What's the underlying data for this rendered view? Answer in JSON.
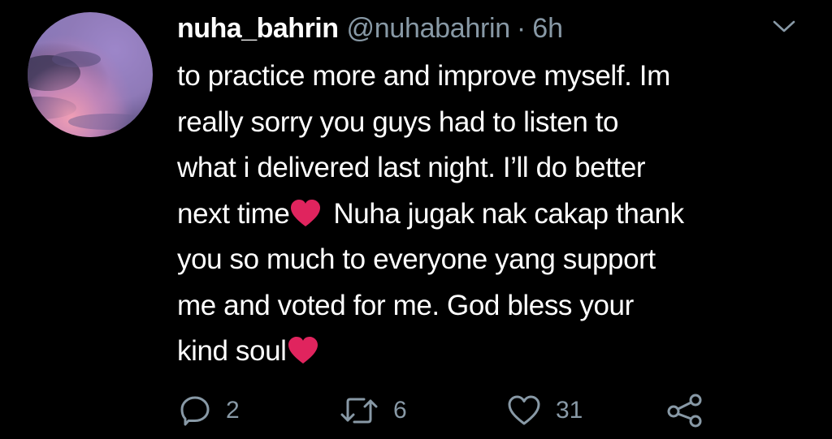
{
  "tweet": {
    "author": {
      "display_name": "nuha_bahrin",
      "handle": "@nuhabahrin",
      "separator": "·",
      "time": "6h"
    },
    "lines": [
      "to practice more and improve myself. Im",
      "really sorry you guys had to listen to",
      "what i delivered last night. I’ll do better"
    ],
    "line4": {
      "before_heart": "next time",
      "after_heart": "Nuha jugak nak cakap thank"
    },
    "lines_after": [
      "you so much to everyone yang support",
      "me and voted for me. God bless your"
    ],
    "last_line": {
      "before_heart": "kind soul"
    },
    "actions": {
      "reply_count": "2",
      "retweet_count": "6",
      "like_count": "31"
    }
  },
  "colors": {
    "background": "#000000",
    "text": "#ffffff",
    "secondary": "#8899a6",
    "heart": "#e0245e"
  },
  "icons": {
    "menu": "chevron-down-icon",
    "reply": "reply-icon",
    "retweet": "retweet-icon",
    "like": "heart-outline-icon",
    "share": "share-icon",
    "emoji": "red-heart-emoji"
  }
}
